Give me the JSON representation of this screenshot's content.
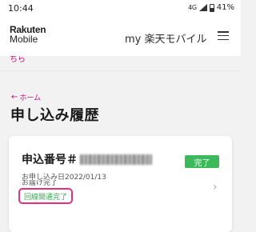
{
  "status_bar": {
    "time": "10:44",
    "network": "4G",
    "battery": "41%"
  },
  "header": {
    "logo_line1": "Rakuten",
    "logo_line2": "Mobile",
    "my_rakuten": "my 楽天モバイル"
  },
  "partial_link": "ちら",
  "breadcrumb": {
    "arrow": "←",
    "label": "ホーム"
  },
  "page_title": "申し込み履歴",
  "card": {
    "app_number_label": "申込番号＃",
    "status_badge": "完了",
    "apply_date": "お申し込み日2022/01/13",
    "delivery": "お届け完了",
    "line_status": "回線開通完了",
    "chevron": "›"
  },
  "colors": {
    "accent": "#bf0b73",
    "badge_green": "#3cb95a",
    "highlight_border": "#e6307c",
    "status_green": "#36a84f"
  }
}
